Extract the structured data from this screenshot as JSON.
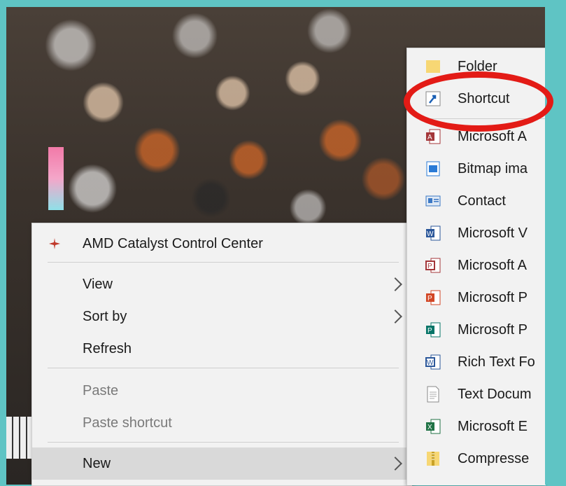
{
  "context_menu": {
    "items": [
      {
        "label": "AMD Catalyst Control Center",
        "icon": "amd-catalyst-icon"
      },
      {
        "label": "View",
        "submenu": true
      },
      {
        "label": "Sort by",
        "submenu": true
      },
      {
        "label": "Refresh"
      },
      {
        "label": "Paste",
        "disabled": true
      },
      {
        "label": "Paste shortcut",
        "disabled": true
      },
      {
        "label": "New",
        "submenu": true,
        "highlighted": true
      }
    ]
  },
  "new_submenu": {
    "items": [
      {
        "label": "Folder",
        "icon": "folder-icon"
      },
      {
        "label": "Shortcut",
        "icon": "shortcut-icon"
      },
      {
        "label": "Microsoft A",
        "icon": "access-icon"
      },
      {
        "label": "Bitmap ima",
        "icon": "bitmap-icon"
      },
      {
        "label": "Contact",
        "icon": "contact-icon"
      },
      {
        "label": "Microsoft V",
        "icon": "word-icon"
      },
      {
        "label": "Microsoft A",
        "icon": "access-pub-icon"
      },
      {
        "label": "Microsoft P",
        "icon": "powerpoint-icon"
      },
      {
        "label": "Microsoft P",
        "icon": "publisher-icon"
      },
      {
        "label": "Rich Text Fo",
        "icon": "rtf-icon"
      },
      {
        "label": "Text Docum",
        "icon": "text-doc-icon"
      },
      {
        "label": "Microsoft E",
        "icon": "excel-icon"
      },
      {
        "label": "Compresse",
        "icon": "zip-icon"
      }
    ]
  },
  "colors": {
    "annotation_ring": "#e31b16",
    "frame": "#5fc4c4",
    "menu_bg": "#f2f2f2",
    "highlight": "#d9d9d9"
  }
}
